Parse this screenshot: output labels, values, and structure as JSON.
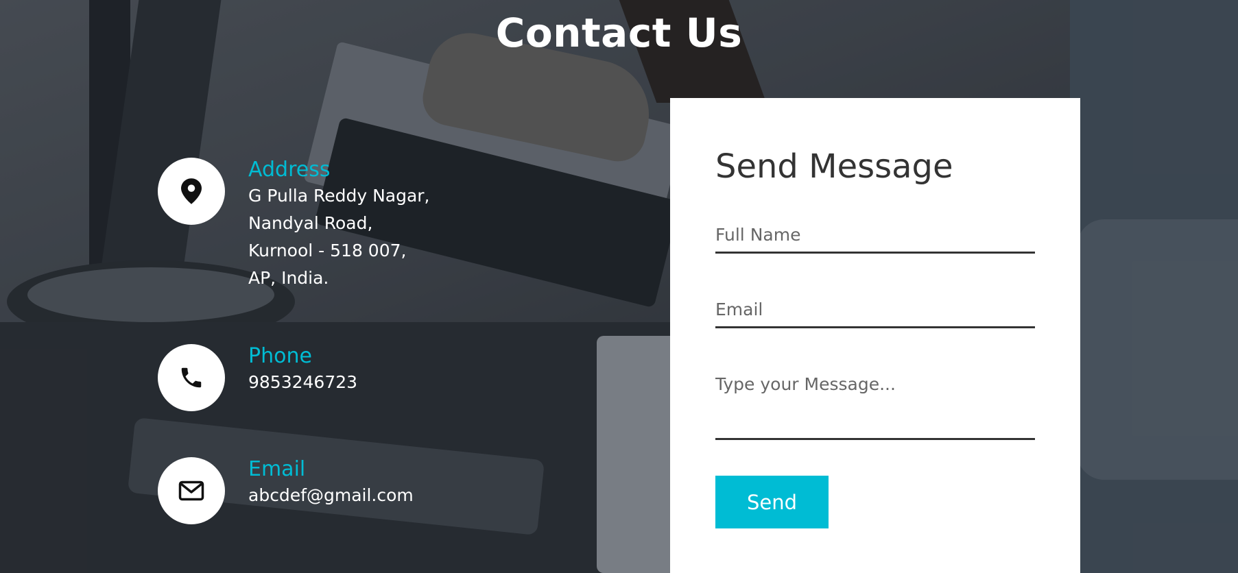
{
  "page": {
    "title": "Contact Us"
  },
  "colors": {
    "accent": "#00bcd4",
    "card": "#ffffff",
    "text_dark": "#333333"
  },
  "contact_info": [
    {
      "icon": "map-pin-icon",
      "label": "Address",
      "value": "G Pulla Reddy Nagar,\nNandyal Road,\nKurnool - 518 007,\nAP, India."
    },
    {
      "icon": "phone-icon",
      "label": "Phone",
      "value": "9853246723"
    },
    {
      "icon": "envelope-icon",
      "label": "Email",
      "value": "abcdef@gmail.com"
    }
  ],
  "form": {
    "title": "Send Message",
    "full_name": {
      "placeholder": "Full Name",
      "value": ""
    },
    "email": {
      "placeholder": "Email",
      "value": ""
    },
    "message": {
      "placeholder": "Type your Message...",
      "value": ""
    },
    "send_label": "Send"
  }
}
